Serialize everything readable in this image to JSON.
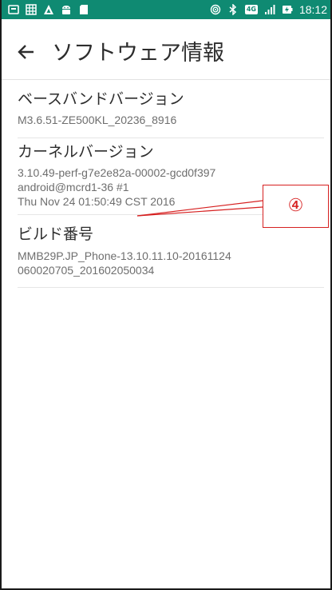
{
  "status_bar": {
    "time": "18:12",
    "network_badge": "4G",
    "left_icons": [
      "notification-icon",
      "calendar-icon",
      "triangle-app-icon",
      "android-icon",
      "sd-card-icon"
    ],
    "right_icons": [
      "hotspot-icon",
      "bluetooth-icon",
      "network-4g-badge",
      "signal-icon",
      "battery-charging-icon"
    ],
    "colors": {
      "background": "#0f8a72",
      "foreground": "#ffffff"
    }
  },
  "toolbar": {
    "title": "ソフトウェア情報",
    "back_icon": "arrow-left-icon"
  },
  "info_items": [
    {
      "title": "ベースバンドバージョン",
      "value_lines": [
        "M3.6.51-ZE500KL_20236_8916"
      ]
    },
    {
      "title": "カーネルバージョン",
      "value_lines": [
        "3.10.49-perf-g7e2e82a-00002-gcd0f397",
        "android@mcrd1-36 #1",
        "Thu Nov 24 01:50:49 CST 2016"
      ]
    },
    {
      "title": "ビルド番号",
      "value_lines": [
        "MMB29P.JP_Phone-13.10.11.10-20161124",
        "060020705_201602050034"
      ]
    }
  ],
  "annotation": {
    "label": "④",
    "color": "#d62020"
  }
}
